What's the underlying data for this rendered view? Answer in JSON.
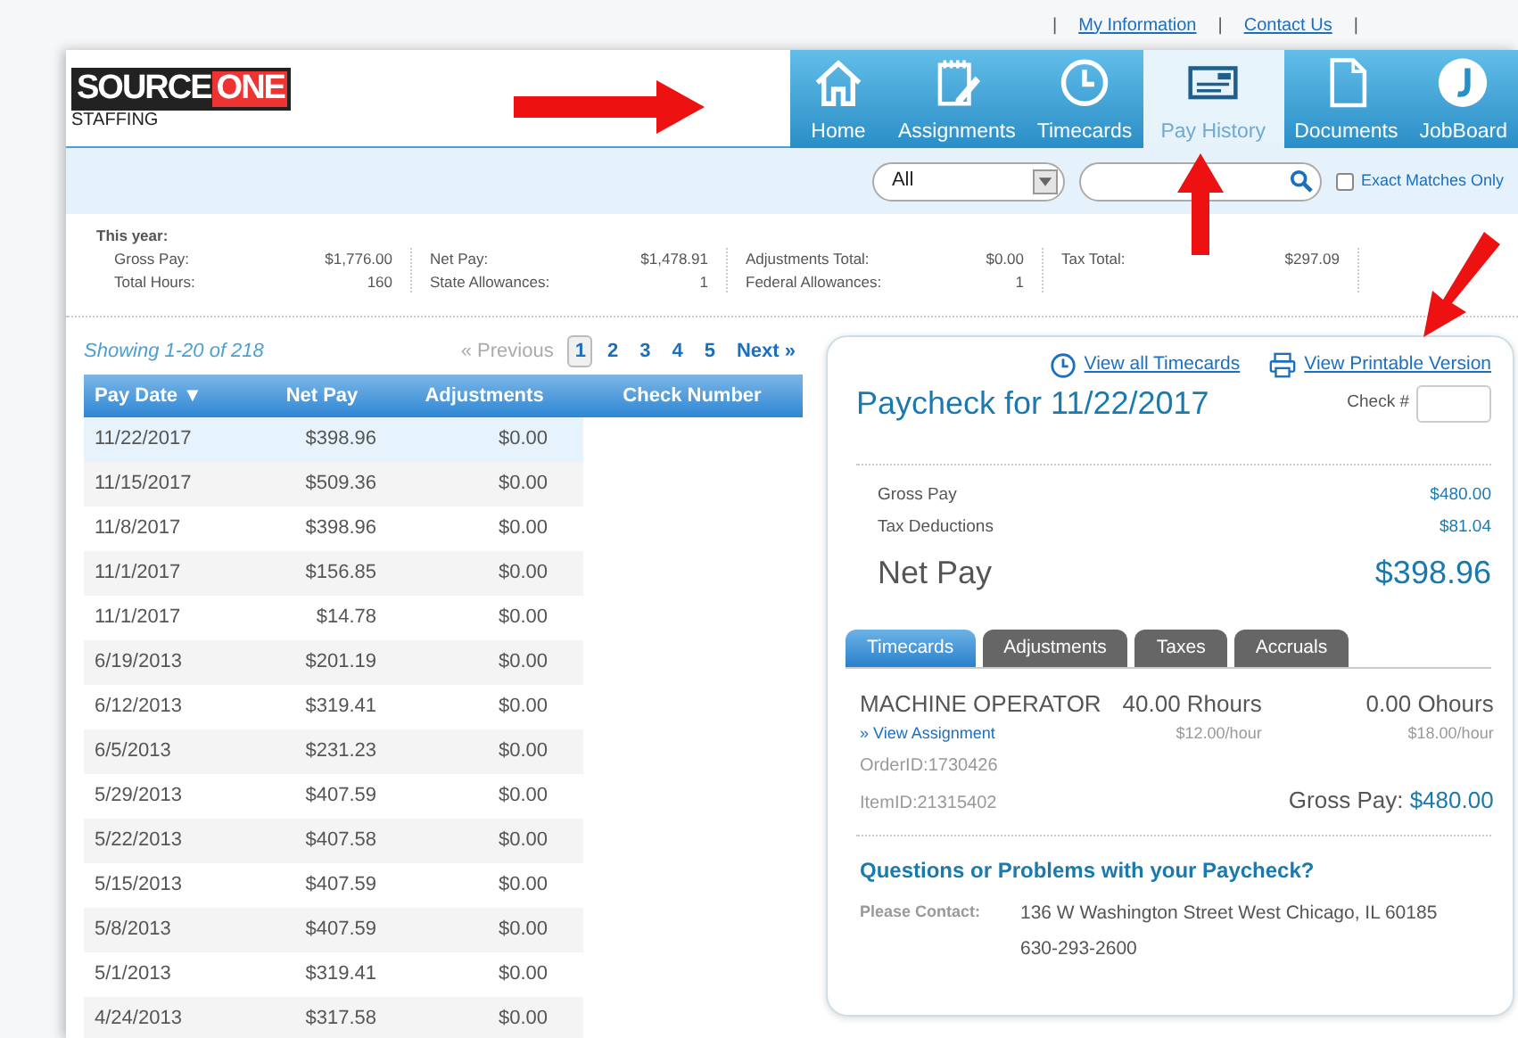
{
  "top_bar": [
    {
      "kind": "sep",
      "text": "|"
    },
    {
      "kind": "link",
      "text": "My Information"
    },
    {
      "kind": "sep",
      "text": "|"
    },
    {
      "kind": "link",
      "text": "Contact Us"
    },
    {
      "kind": "sep",
      "text": "|"
    }
  ],
  "logo": {
    "main": "SOURCE",
    "accent": "ONE",
    "sub": "STAFFING"
  },
  "nav": [
    {
      "label": "Home",
      "kind": "home",
      "selected": false
    },
    {
      "label": "Assignments",
      "kind": "notepad",
      "selected": false
    },
    {
      "label": "Timecards",
      "kind": "clock",
      "selected": false
    },
    {
      "label": "Pay History",
      "kind": "check",
      "selected": true
    },
    {
      "label": "Documents",
      "kind": "document",
      "selected": false
    },
    {
      "label": "JobBoard",
      "kind": "jobboard",
      "selected": false
    }
  ],
  "filter": {
    "select": "All",
    "exact_label": "Exact Matches Only",
    "exact_checked": false
  },
  "summary": {
    "title": "This year:",
    "groups": [
      [
        {
          "label": "Gross Pay:",
          "value": "$1,776.00"
        },
        {
          "label": "Total Hours:",
          "value": "160"
        }
      ],
      [
        {
          "label": "Net Pay:",
          "value": "$1,478.91"
        },
        {
          "label": "State Allowances:",
          "value": "1"
        }
      ],
      [
        {
          "label": "Adjustments Total:",
          "value": "$0.00"
        },
        {
          "label": "Federal Allowances:",
          "value": "1"
        }
      ],
      [
        {
          "label": "Tax Total:",
          "value": "$297.09"
        }
      ]
    ]
  },
  "pagination": {
    "showing": "Showing 1-20 of 218",
    "previous": "« Previous",
    "previous_disabled": true,
    "pages": [
      {
        "label": "1",
        "selected": true
      },
      {
        "label": "2",
        "selected": false
      },
      {
        "label": "3",
        "selected": false
      },
      {
        "label": "4",
        "selected": false
      },
      {
        "label": "5",
        "selected": false
      }
    ],
    "next": "Next »"
  },
  "table": {
    "columns": [
      {
        "label": "Pay Date",
        "sort": "▼"
      },
      {
        "label": "Net Pay"
      },
      {
        "label": "Adjustments"
      },
      {
        "label": "Check Number"
      }
    ],
    "rows": [
      {
        "date": "11/22/2017",
        "net": "$398.96",
        "adj": "$0.00",
        "selected": true
      },
      {
        "date": "11/15/2017",
        "net": "$509.36",
        "adj": "$0.00",
        "selected": false
      },
      {
        "date": "11/8/2017",
        "net": "$398.96",
        "adj": "$0.00",
        "selected": false
      },
      {
        "date": "11/1/2017",
        "net": "$156.85",
        "adj": "$0.00",
        "selected": false
      },
      {
        "date": "11/1/2017",
        "net": "$14.78",
        "adj": "$0.00",
        "selected": false
      },
      {
        "date": "6/19/2013",
        "net": "$201.19",
        "adj": "$0.00",
        "selected": false
      },
      {
        "date": "6/12/2013",
        "net": "$319.41",
        "adj": "$0.00",
        "selected": false
      },
      {
        "date": "6/5/2013",
        "net": "$231.23",
        "adj": "$0.00",
        "selected": false
      },
      {
        "date": "5/29/2013",
        "net": "$407.59",
        "adj": "$0.00",
        "selected": false
      },
      {
        "date": "5/22/2013",
        "net": "$407.58",
        "adj": "$0.00",
        "selected": false
      },
      {
        "date": "5/15/2013",
        "net": "$407.59",
        "adj": "$0.00",
        "selected": false
      },
      {
        "date": "5/8/2013",
        "net": "$407.59",
        "adj": "$0.00",
        "selected": false
      },
      {
        "date": "5/1/2013",
        "net": "$319.41",
        "adj": "$0.00",
        "selected": false
      },
      {
        "date": "4/24/2013",
        "net": "$317.58",
        "adj": "$0.00",
        "selected": false
      }
    ]
  },
  "paycheck": {
    "links": [
      {
        "kind": "clock",
        "text": "View all Timecards"
      },
      {
        "kind": "printer",
        "text": "View Printable Version"
      }
    ],
    "title": "Paycheck for 11/22/2017",
    "check_label": "Check #",
    "lines": [
      {
        "label": "Gross Pay",
        "value": "$480.00"
      },
      {
        "label": "Tax Deductions",
        "value": "$81.04"
      }
    ],
    "net": {
      "label": "Net Pay",
      "value": "$398.96"
    },
    "tabs": [
      {
        "label": "Timecards",
        "selected": true
      },
      {
        "label": "Adjustments",
        "selected": false
      },
      {
        "label": "Taxes",
        "selected": false
      },
      {
        "label": "Accruals",
        "selected": false
      }
    ],
    "timecard": {
      "job": "MACHINE OPERATOR",
      "view_link": "» View Assignment",
      "order": "OrderID:1730426",
      "item": "ItemID:21315402",
      "hours": [
        {
          "amount": "40.00 Rhours",
          "rate": "$12.00/hour"
        },
        {
          "amount": "0.00 Ohours",
          "rate": "$18.00/hour"
        }
      ],
      "gross_label": "Gross Pay:",
      "gross_value": "$480.00"
    },
    "contact": {
      "heading": "Questions or Problems with your Paycheck?",
      "label": "Please Contact:",
      "address": "136 W Washington Street West Chicago, IL 60185",
      "phone": "630-293-2600"
    }
  }
}
